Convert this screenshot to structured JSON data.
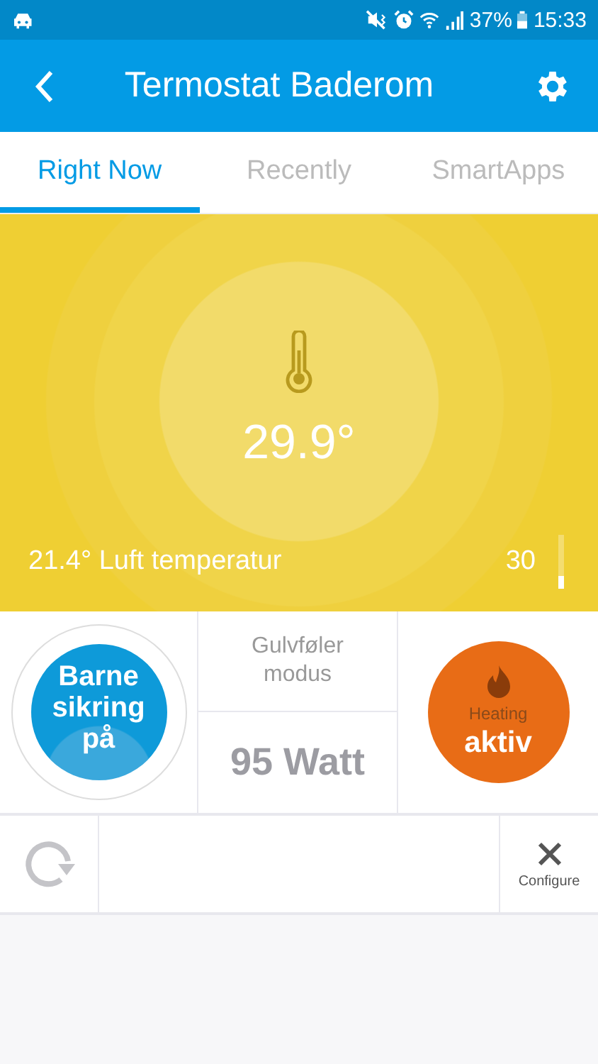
{
  "status_bar": {
    "battery": "37%",
    "time": "15:33"
  },
  "app_bar": {
    "title": "Termostat Baderom"
  },
  "tabs": [
    {
      "label": "Right Now",
      "selected": true
    },
    {
      "label": "Recently",
      "selected": false
    },
    {
      "label": "SmartApps",
      "selected": false
    }
  ],
  "hero": {
    "temperature": "29.9°",
    "air_temperature": "21.4° Luft temperatur",
    "setpoint": "30",
    "level": 0.25
  },
  "tiles": {
    "child_lock": "Barne\nsikring\npå",
    "mode_label": "Gulvføler\nmodus",
    "power": "95 Watt",
    "heating_label": "Heating",
    "heating_state": "aktiv"
  },
  "bottom_row": {
    "configure": "Configure"
  }
}
